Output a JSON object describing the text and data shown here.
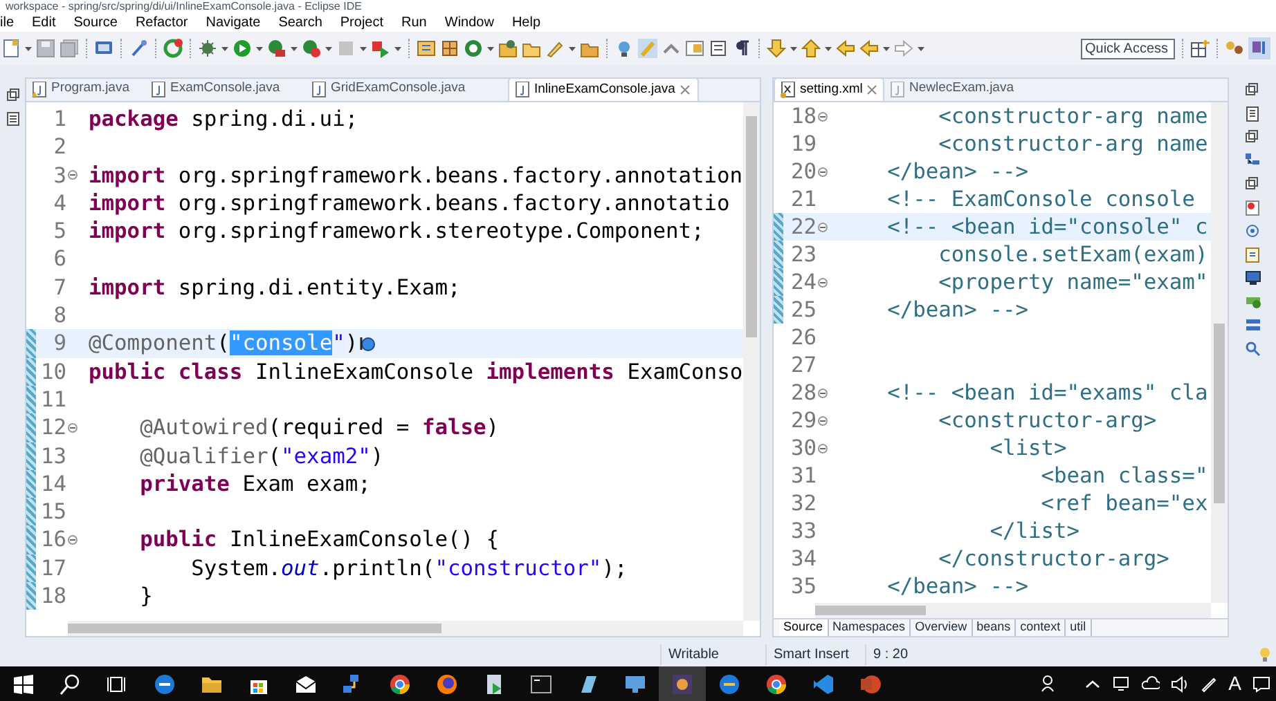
{
  "window": {
    "title": "workspace - spring/src/spring/di/ui/InlineExamConsole.java - Eclipse IDE"
  },
  "menu": [
    "ile",
    "Edit",
    "Source",
    "Refactor",
    "Navigate",
    "Search",
    "Project",
    "Run",
    "Window",
    "Help"
  ],
  "quick_access": {
    "placeholder": "Quick Access"
  },
  "left_editor": {
    "tabs": [
      {
        "label": "Program.java",
        "selected": false
      },
      {
        "label": "ExamConsole.java",
        "selected": false
      },
      {
        "label": "GridExamConsole.java",
        "selected": false
      },
      {
        "label": "InlineExamConsole.java",
        "selected": true,
        "closable": true
      }
    ],
    "lines": [
      {
        "number": "1",
        "segments": [
          {
            "kind": "keyword",
            "text": "package"
          },
          {
            "kind": "plain",
            "text": " spring.di.ui;"
          }
        ]
      },
      {
        "number": "2"
      },
      {
        "number": "3",
        "fold": true,
        "segments": [
          {
            "kind": "keyword",
            "text": "import"
          },
          {
            "kind": "plain",
            "text": " org.springframework.beans.factory.annotation"
          }
        ]
      },
      {
        "number": "4",
        "segments": [
          {
            "kind": "keyword",
            "text": "import"
          },
          {
            "kind": "plain",
            "text": " org.springframework.beans.factory.annotatio"
          }
        ]
      },
      {
        "number": "5",
        "segments": [
          {
            "kind": "keyword",
            "text": "import"
          },
          {
            "kind": "plain",
            "text": " org.springframework.stereotype.Component;"
          }
        ]
      },
      {
        "number": "6"
      },
      {
        "number": "7",
        "segments": [
          {
            "kind": "keyword",
            "text": "import"
          },
          {
            "kind": "plain",
            "text": " spring.di.entity.Exam;"
          }
        ]
      },
      {
        "number": "8"
      },
      {
        "number": "9",
        "changed": true,
        "current": true,
        "segments": [
          {
            "kind": "annotation",
            "text": "@Component"
          },
          {
            "kind": "plain",
            "text": "("
          },
          {
            "kind": "string",
            "text": "\"console",
            "selected": true
          },
          {
            "kind": "string",
            "text": "\""
          },
          {
            "kind": "plain",
            "text": ")"
          }
        ]
      },
      {
        "number": "10",
        "changed": true,
        "segments": [
          {
            "kind": "keyword",
            "text": "public class"
          },
          {
            "kind": "plain",
            "text": " InlineExamConsole "
          },
          {
            "kind": "keyword",
            "text": "implements"
          },
          {
            "kind": "plain",
            "text": " ExamConso"
          }
        ]
      },
      {
        "number": "11",
        "changed": true
      },
      {
        "number": "12",
        "fold": true,
        "changed": true,
        "segments": [
          {
            "kind": "annotation",
            "text": "    @Autowired"
          },
          {
            "kind": "plain",
            "text": "(required = "
          },
          {
            "kind": "keyword",
            "text": "false"
          },
          {
            "kind": "plain",
            "text": ")"
          }
        ]
      },
      {
        "number": "13",
        "changed": true,
        "segments": [
          {
            "kind": "annotation",
            "text": "    @Qualifier"
          },
          {
            "kind": "plain",
            "text": "("
          },
          {
            "kind": "string",
            "text": "\"exam2\""
          },
          {
            "kind": "plain",
            "text": ")"
          }
        ]
      },
      {
        "number": "14",
        "changed": true,
        "segments": [
          {
            "kind": "keyword",
            "text": "    private"
          },
          {
            "kind": "plain",
            "text": " Exam exam;"
          }
        ]
      },
      {
        "number": "15",
        "changed": true
      },
      {
        "number": "16",
        "fold": true,
        "changed": true,
        "segments": [
          {
            "kind": "keyword",
            "text": "    public"
          },
          {
            "kind": "plain",
            "text": " InlineExamConsole() {"
          }
        ]
      },
      {
        "number": "17",
        "changed": true,
        "segments": [
          {
            "kind": "plain",
            "text": "        System."
          },
          {
            "kind": "static",
            "text": "out"
          },
          {
            "kind": "plain",
            "text": ".println("
          },
          {
            "kind": "string",
            "text": "\"constructor\""
          },
          {
            "kind": "plain",
            "text": ");"
          }
        ]
      },
      {
        "number": "18",
        "changed": true,
        "segments": [
          {
            "kind": "plain",
            "text": "    }"
          }
        ]
      }
    ]
  },
  "right_editor": {
    "tabs": [
      {
        "label": "setting.xml",
        "selected": true,
        "closable": true
      },
      {
        "label": "NewlecExam.java",
        "selected": false
      }
    ],
    "lines": [
      {
        "number": "18",
        "fold": true,
        "segments": [
          {
            "kind": "tag",
            "text": "        <constructor-arg name"
          }
        ]
      },
      {
        "number": "19",
        "segments": [
          {
            "kind": "tag",
            "text": "        <constructor-arg name"
          }
        ]
      },
      {
        "number": "20",
        "fold": true,
        "segments": [
          {
            "kind": "tag",
            "text": "    </bean> -->"
          }
        ]
      },
      {
        "number": "21",
        "segments": [
          {
            "kind": "tag",
            "text": "    <!-- ExamConsole console"
          }
        ]
      },
      {
        "number": "22",
        "fold": true,
        "changed": true,
        "current": true,
        "segments": [
          {
            "kind": "tag",
            "text": "    <!-- <bean id=\"console\" c"
          }
        ]
      },
      {
        "number": "23",
        "changed": true,
        "segments": [
          {
            "kind": "tag",
            "text": "        console.setExam(exam)"
          }
        ]
      },
      {
        "number": "24",
        "fold": true,
        "changed": true,
        "segments": [
          {
            "kind": "tag",
            "text": "        <property name=\"exam\""
          }
        ]
      },
      {
        "number": "25",
        "changed": true,
        "segments": [
          {
            "kind": "tag",
            "text": "    </bean> -->"
          }
        ]
      },
      {
        "number": "26"
      },
      {
        "number": "27"
      },
      {
        "number": "28",
        "fold": true,
        "segments": [
          {
            "kind": "tag",
            "text": "    <!-- <bean id=\"exams\" cla"
          }
        ]
      },
      {
        "number": "29",
        "fold": true,
        "segments": [
          {
            "kind": "tag",
            "text": "        <constructor-arg>"
          }
        ]
      },
      {
        "number": "30",
        "fold": true,
        "segments": [
          {
            "kind": "tag",
            "text": "            <list>"
          }
        ]
      },
      {
        "number": "31",
        "segments": [
          {
            "kind": "tag",
            "text": "                <bean class=\""
          }
        ]
      },
      {
        "number": "32",
        "segments": [
          {
            "kind": "tag",
            "text": "                <ref bean=\"ex"
          }
        ]
      },
      {
        "number": "33",
        "segments": [
          {
            "kind": "tag",
            "text": "            </list>"
          }
        ]
      },
      {
        "number": "34",
        "segments": [
          {
            "kind": "tag",
            "text": "        </constructor-arg>"
          }
        ]
      },
      {
        "number": "35",
        "segments": [
          {
            "kind": "tag",
            "text": "    </bean> -->"
          }
        ]
      }
    ],
    "bottom_tabs": [
      {
        "label": "Source",
        "selected": true
      },
      {
        "label": "Namespaces",
        "selected": false
      },
      {
        "label": "Overview",
        "selected": false
      },
      {
        "label": "beans",
        "selected": false
      },
      {
        "label": "context",
        "selected": false
      },
      {
        "label": "util",
        "selected": false
      }
    ]
  },
  "status_bar": [
    "Writable",
    "Smart Insert",
    "9 : 20"
  ],
  "taskbar": {
    "input_indicator": "A"
  }
}
